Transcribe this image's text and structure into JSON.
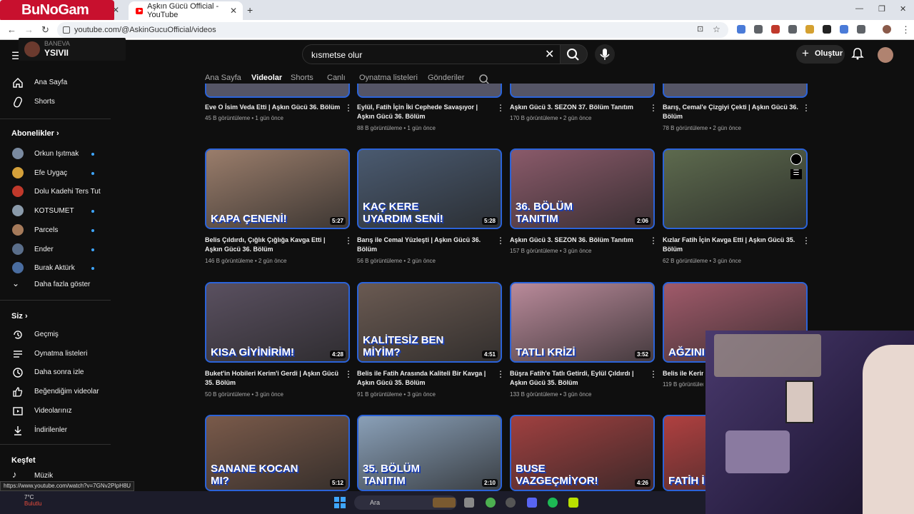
{
  "browser": {
    "tabs": [
      {
        "label": "BuNoGam"
      },
      {
        "label": "Aşkın Gücü Official - YouTube",
        "active": true
      }
    ],
    "new_tab": "+",
    "url": "youtube.com/@AskinGucuOfficial/videos",
    "status_url": "https://www.youtube.com/watch?v=7GNv2PIpH8U"
  },
  "overlay": {
    "logo": "BuNoGam",
    "reservation_line1": "BANEVA",
    "reservation_line2": "YSIVII"
  },
  "header": {
    "search_query": "kısmetse olur",
    "create_label": "Oluştur"
  },
  "sidebar": {
    "main": [
      {
        "label": "Ana Sayfa",
        "icon": "home-icon"
      },
      {
        "label": "Shorts",
        "icon": "shorts-icon"
      }
    ],
    "subs_title": "Abonelikler",
    "subs": [
      {
        "label": "Orkun Işıtmak",
        "color": "#7a8aa0",
        "dot": true
      },
      {
        "label": "Efe Uygaç",
        "color": "#d4a03a",
        "dot": true
      },
      {
        "label": "Dolu Kadehi Ters Tut",
        "color": "#c0392b",
        "dot": false
      },
      {
        "label": "KOTSUMET",
        "color": "#8a9aaa",
        "dot": true
      },
      {
        "label": "Parcels",
        "color": "#a57a5a",
        "dot": true
      },
      {
        "label": "Ender",
        "color": "#5a6e8a",
        "dot": true
      },
      {
        "label": "Burak Aktürk",
        "color": "#4a6da0",
        "dot": true
      }
    ],
    "show_more": "Daha fazla göster",
    "you_title": "Siz",
    "you": [
      {
        "label": "Geçmiş",
        "icon": "history-icon"
      },
      {
        "label": "Oynatma listeleri",
        "icon": "playlist-icon"
      },
      {
        "label": "Daha sonra izle",
        "icon": "watch-later-icon"
      },
      {
        "label": "Beğendiğim videolar",
        "icon": "like-icon"
      },
      {
        "label": "Videolarınız",
        "icon": "your-videos-icon"
      },
      {
        "label": "İndirilenler",
        "icon": "download-icon"
      }
    ],
    "explore_title": "Keşfet",
    "explore": [
      {
        "label": "Müzik",
        "icon": "music-icon"
      }
    ]
  },
  "channel_tabs": [
    "Ana Sayfa",
    "Videolar",
    "Shorts",
    "Canlı",
    "Oynatma listeleri",
    "Gönderiler"
  ],
  "selected_tab": "Videolar",
  "rows": [
    [
      {
        "title": "Eve O İsim Veda Etti | Aşkın Gücü 36. Bölüm",
        "meta": "45 B görüntüleme • 1 gün önce"
      },
      {
        "title": "Eylül, Fatih İçin İki Cephede Savaşıyor | Aşkın Gücü 36. Bölüm",
        "meta": "88 B görüntüleme • 1 gün önce"
      },
      {
        "title": "Aşkın Gücü 3. SEZON 37. Bölüm Tanıtım",
        "meta": "170 B görüntüleme • 2 gün önce"
      },
      {
        "title": "Barış, Cemal'e Çizgiyi Çekti | Aşkın Gücü 36. Bölüm",
        "meta": "78 B görüntüleme • 2 gün önce"
      }
    ],
    [
      {
        "title": "Belis Çıldırdı, Çığlık Çığlığa Kavga Etti | Aşkın Gücü 36. Bölüm",
        "meta": "146 B görüntüleme • 2 gün önce",
        "cap": "KAPA ÇENENİ!",
        "dur": "5:27",
        "bg": "#9a7d6b"
      },
      {
        "title": "Barış ile Cemal Yüzleşti | Aşkın Gücü 36. Bölüm",
        "meta": "56 B görüntüleme • 2 gün önce",
        "cap": "KAÇ KERE UYARDIM SENİ!",
        "dur": "5:28",
        "bg": "#4a5a70"
      },
      {
        "title": "Aşkın Gücü 3. SEZON 36. Bölüm Tanıtım",
        "meta": "157 B görüntüleme • 3 gün önce",
        "cap": "36. BÖLÜM TANITIM",
        "dur": "2:06",
        "bg": "#8a5a6a"
      },
      {
        "title": "Kızlar Fatih İçin Kavga Etti | Aşkın Gücü 35. Bölüm",
        "meta": "62 B görüntüleme • 3 gün önce",
        "cap": "",
        "dur": "",
        "bg": "#5d6a4e"
      }
    ],
    [
      {
        "title": "Buket'in Hobileri Kerim'i Gerdi | Aşkın Gücü 35. Bölüm",
        "meta": "50 B görüntüleme • 3 gün önce",
        "cap": "KISA GİYİNİRİM!",
        "dur": "4:28",
        "bg": "#5a5060"
      },
      {
        "title": "Belis ile Fatih Arasında Kaliteli Bir Kavga | Aşkın Gücü 35. Bölüm",
        "meta": "91 B görüntüleme • 3 gün önce",
        "cap": "KALİTESİZ BEN MİYİM?",
        "dur": "4:51",
        "bg": "#6a5a52"
      },
      {
        "title": "Büşra Fatih'e Tatlı Getirdi, Eylül Çıldırdı | Aşkın Gücü 35. Bölüm",
        "meta": "133 B görüntüleme • 3 gün önce",
        "cap": "TATLI KRİZİ",
        "dur": "3:52",
        "bg": "#b98a9a"
      },
      {
        "title": "Belis ile Kerim",
        "meta": "119 B görüntüleme",
        "cap": "AĞZINI BANTL",
        "dur": "",
        "bg": "#a05a6a"
      }
    ],
    [
      {
        "cap": "SANANE KOCAN MI?",
        "dur": "5:12",
        "bg": "#7a5a4a"
      },
      {
        "cap": "35. BÖLÜM TANITIM",
        "dur": "2:10",
        "bg": "#8aa0b8"
      },
      {
        "cap": "BUSE VAZGEÇMİYOR!",
        "dur": "4:26",
        "bg": "#a04040"
      },
      {
        "cap": "FATİH İ AĞLAD",
        "dur": "",
        "bg": "#b04040"
      }
    ]
  ],
  "taskbar": {
    "temp": "7°C",
    "weather": "Bulutlu",
    "search": "Ara"
  }
}
